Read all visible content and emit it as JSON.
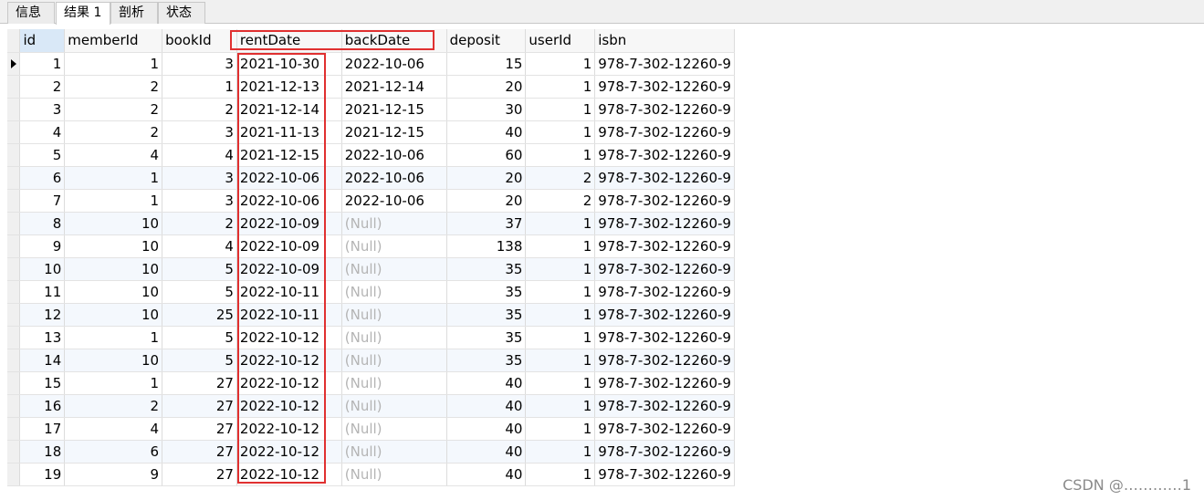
{
  "tabs": [
    {
      "label": "信息"
    },
    {
      "label": "结果 1"
    },
    {
      "label": "剖析"
    },
    {
      "label": "状态"
    }
  ],
  "columns": [
    "id",
    "memberId",
    "bookId",
    "rentDate",
    "backDate",
    "deposit",
    "userId",
    "isbn"
  ],
  "rows": [
    [
      "1",
      "1",
      "3",
      "2021-10-30",
      "2022-10-06",
      "15",
      "1",
      "978-7-302-12260-9"
    ],
    [
      "2",
      "2",
      "1",
      "2021-12-13",
      "2021-12-14",
      "20",
      "1",
      "978-7-302-12260-9"
    ],
    [
      "3",
      "2",
      "2",
      "2021-12-14",
      "2021-12-15",
      "30",
      "1",
      "978-7-302-12260-9"
    ],
    [
      "4",
      "2",
      "3",
      "2021-11-13",
      "2021-12-15",
      "40",
      "1",
      "978-7-302-12260-9"
    ],
    [
      "5",
      "4",
      "4",
      "2021-12-15",
      "2022-10-06",
      "60",
      "1",
      "978-7-302-12260-9"
    ],
    [
      "6",
      "1",
      "3",
      "2022-10-06",
      "2022-10-06",
      "20",
      "2",
      "978-7-302-12260-9"
    ],
    [
      "7",
      "1",
      "3",
      "2022-10-06",
      "2022-10-06",
      "20",
      "2",
      "978-7-302-12260-9"
    ],
    [
      "8",
      "10",
      "2",
      "2022-10-09",
      "(Null)",
      "37",
      "1",
      "978-7-302-12260-9"
    ],
    [
      "9",
      "10",
      "4",
      "2022-10-09",
      "(Null)",
      "138",
      "1",
      "978-7-302-12260-9"
    ],
    [
      "10",
      "10",
      "5",
      "2022-10-09",
      "(Null)",
      "35",
      "1",
      "978-7-302-12260-9"
    ],
    [
      "11",
      "10",
      "5",
      "2022-10-11",
      "(Null)",
      "35",
      "1",
      "978-7-302-12260-9"
    ],
    [
      "12",
      "10",
      "25",
      "2022-10-11",
      "(Null)",
      "35",
      "1",
      "978-7-302-12260-9"
    ],
    [
      "13",
      "1",
      "5",
      "2022-10-12",
      "(Null)",
      "35",
      "1",
      "978-7-302-12260-9"
    ],
    [
      "14",
      "10",
      "5",
      "2022-10-12",
      "(Null)",
      "35",
      "1",
      "978-7-302-12260-9"
    ],
    [
      "15",
      "1",
      "27",
      "2022-10-12",
      "(Null)",
      "40",
      "1",
      "978-7-302-12260-9"
    ],
    [
      "16",
      "2",
      "27",
      "2022-10-12",
      "(Null)",
      "40",
      "1",
      "978-7-302-12260-9"
    ],
    [
      "17",
      "4",
      "27",
      "2022-10-12",
      "(Null)",
      "40",
      "1",
      "978-7-302-12260-9"
    ],
    [
      "18",
      "6",
      "27",
      "2022-10-12",
      "(Null)",
      "40",
      "1",
      "978-7-302-12260-9"
    ],
    [
      "19",
      "9",
      "27",
      "2022-10-12",
      "(Null)",
      "40",
      "1",
      "978-7-302-12260-9"
    ]
  ],
  "watermark": "CSDN @…………1",
  "colors": {
    "highlight": "#e03030",
    "null_text": "#b4b4b4",
    "selected_header": "#d9e8f7",
    "alt_row": "#f4f8fd"
  },
  "icons": {
    "current_row": "row-pointer-icon"
  }
}
